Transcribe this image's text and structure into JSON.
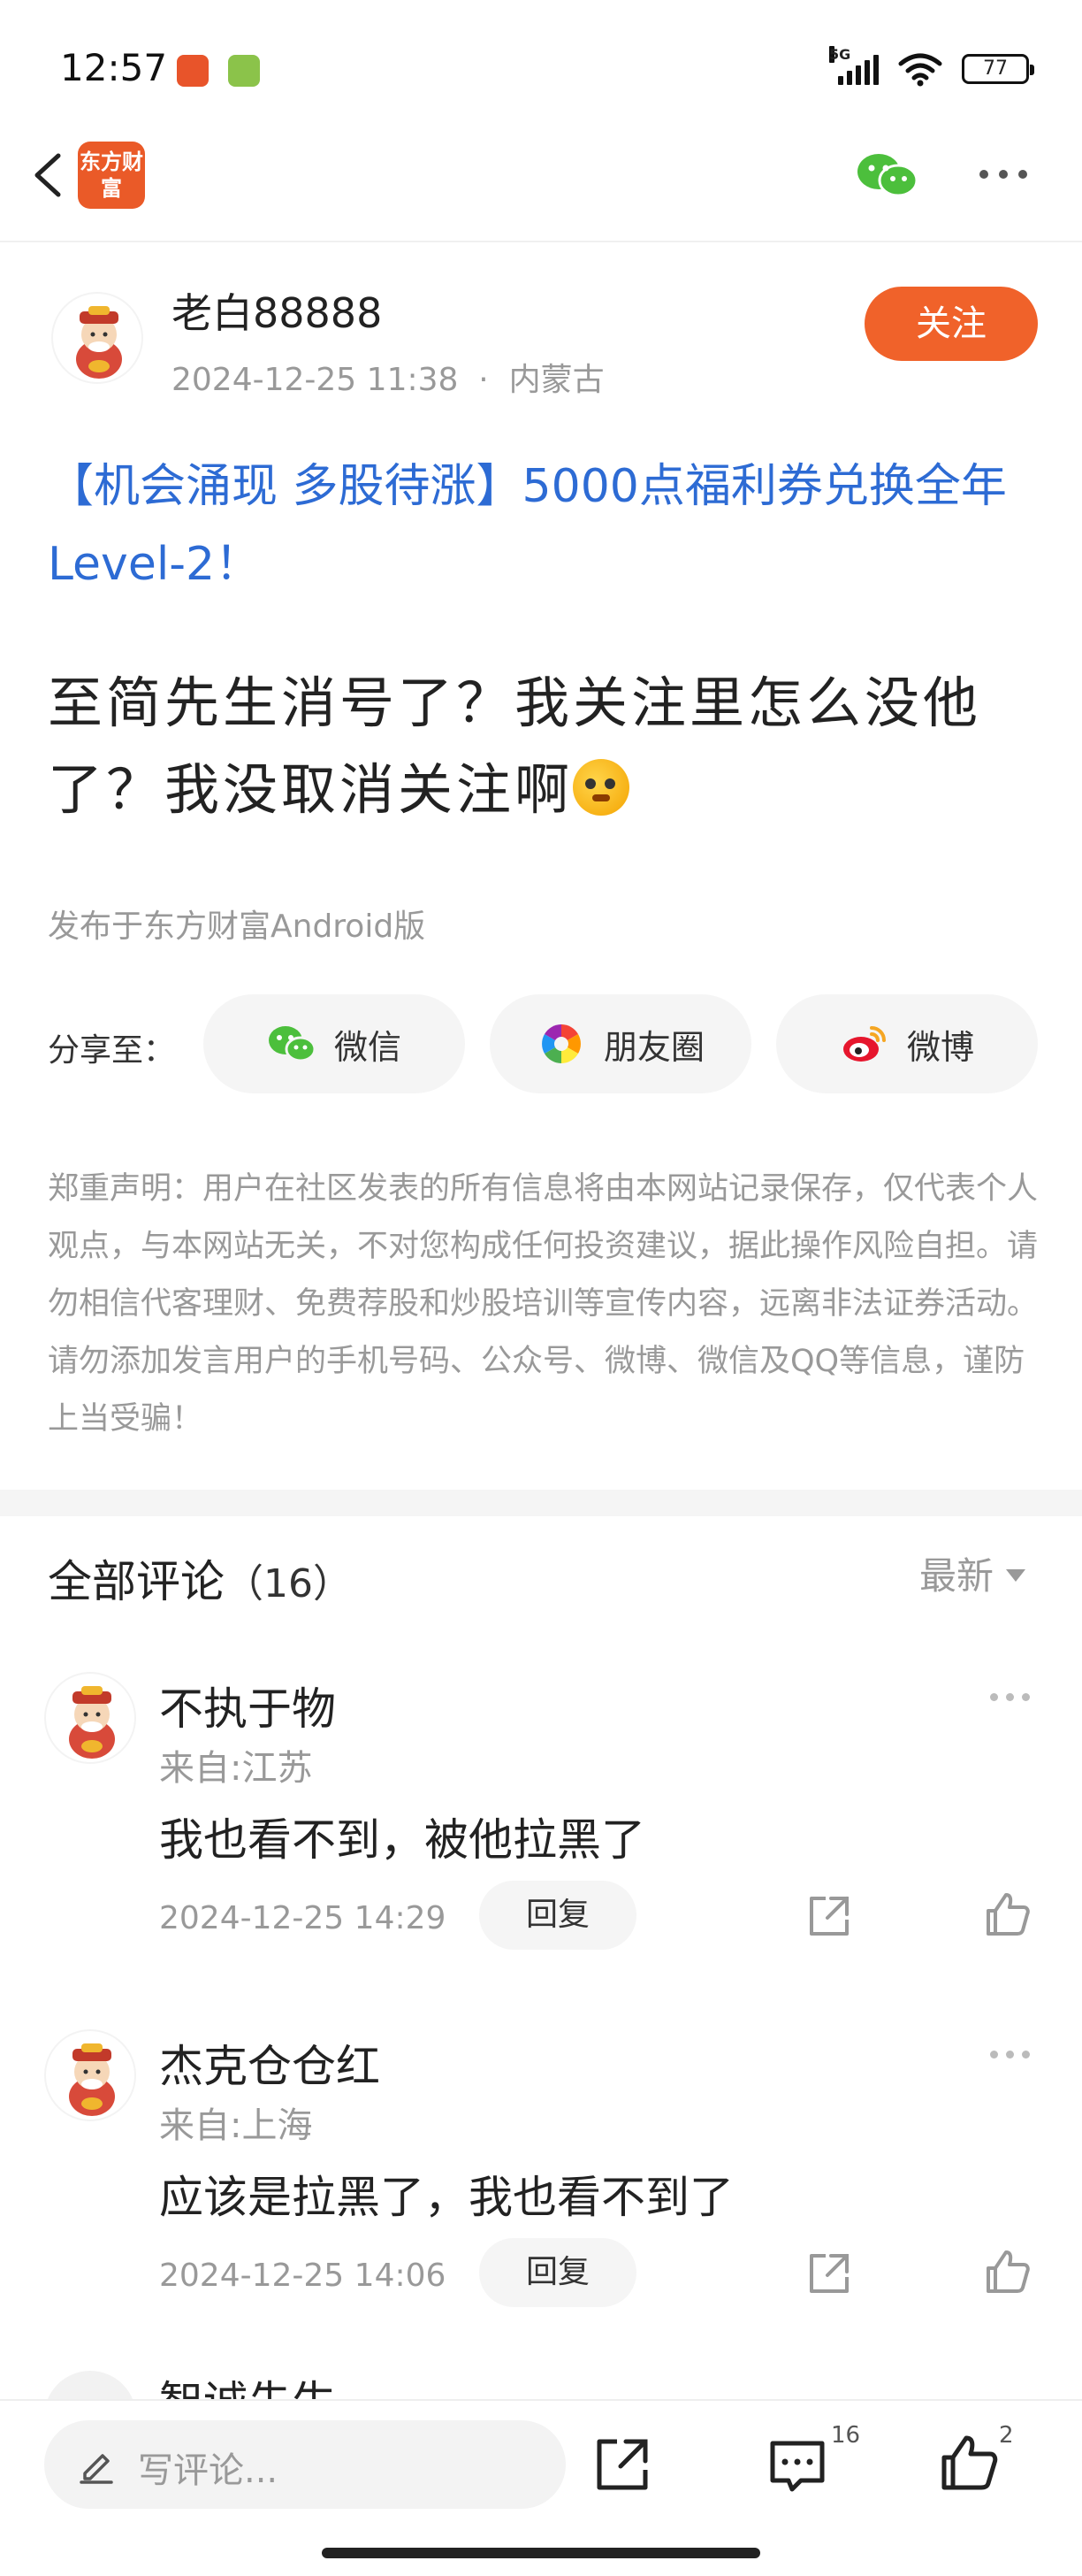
{
  "status_bar": {
    "time": "12:57",
    "network": "5G",
    "battery": "77"
  },
  "nav": {
    "logo_text": "东方财富"
  },
  "author": {
    "name": "老白88888",
    "timestamp": "2024-12-25 11:38",
    "location": "内蒙古",
    "follow_label": "关注"
  },
  "post": {
    "title": "【机会涌现 多股待涨】5000点福利券兑换全年Level-2！",
    "body": "至简先生消号了？我关注里怎么没他了？我没取消关注啊",
    "publish_from": "发布于东方财富Android版"
  },
  "share": {
    "label": "分享至：",
    "wechat": "微信",
    "moments": "朋友圈",
    "weibo": "微博"
  },
  "disclaimer": "郑重声明：用户在社区发表的所有信息将由本网站记录保存，仅代表个人观点，与本网站无关，不对您构成任何投资建议，据此操作风险自担。请勿相信代客理财、免费荐股和炒股培训等宣传内容，远离非法证券活动。请勿添加发言用户的手机号码、公众号、微博、微信及QQ等信息，谨防上当受骗！",
  "comments": {
    "title": "全部评论",
    "count": "（16）",
    "sort": "最新",
    "reply_label": "回复",
    "items": [
      {
        "name": "不执于物",
        "location": "来自:江苏",
        "text": "我也看不到，被他拉黑了",
        "time": "2024-12-25 14:29"
      },
      {
        "name": "杰克仓仓红",
        "location": "来自:上海",
        "text": "应该是拉黑了，我也看不到了",
        "time": "2024-12-25 14:06"
      }
    ],
    "partial_name": "智诚先生"
  },
  "bottom_bar": {
    "placeholder": "写评论...",
    "comment_count": "16",
    "like_count": "2"
  },
  "colors": {
    "accent": "#f0622a",
    "link_blue": "#2d6bd4",
    "muted": "#999999"
  }
}
